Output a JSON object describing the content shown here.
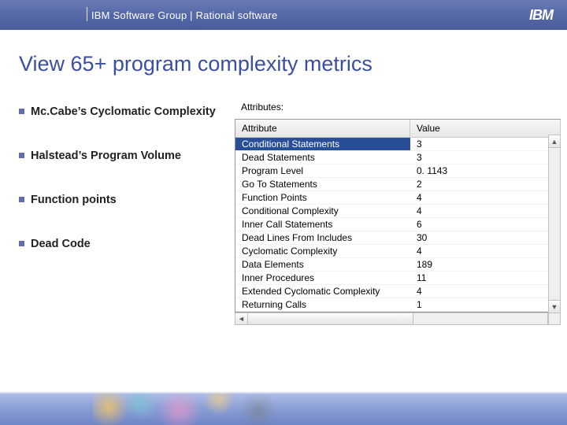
{
  "header": {
    "breadcrumb": "IBM Software Group | Rational software",
    "logo_text": "IBM"
  },
  "title": "View 65+ program complexity metrics",
  "bullets": [
    "Mc.Cabe’s Cyclomatic Complexity",
    "Halstead’s Program Volume",
    "Function points",
    "Dead Code"
  ],
  "panel": {
    "label": "Attributes:",
    "columns": {
      "attr": "Attribute",
      "value": "Value"
    },
    "rows": [
      {
        "attr": "Conditional Statements",
        "value": "3",
        "selected": true
      },
      {
        "attr": "Dead Statements",
        "value": "3"
      },
      {
        "attr": "Program Level",
        "value": "0. 1143"
      },
      {
        "attr": "Go To Statements",
        "value": "2"
      },
      {
        "attr": "Function Points",
        "value": "4"
      },
      {
        "attr": "Conditional Complexity",
        "value": "4"
      },
      {
        "attr": "Inner Call Statements",
        "value": "6"
      },
      {
        "attr": "Dead Lines From Includes",
        "value": "30"
      },
      {
        "attr": "Cyclomatic Complexity",
        "value": "4"
      },
      {
        "attr": "Data Elements",
        "value": "189"
      },
      {
        "attr": "Inner Procedures",
        "value": "11"
      },
      {
        "attr": "Extended Cyclomatic Complexity",
        "value": "4"
      },
      {
        "attr": "Returning Calls",
        "value": "1"
      }
    ]
  },
  "colors": {
    "accent": "#3a4fa0",
    "header_bg": "#5568a8",
    "selection": "#284e98"
  }
}
